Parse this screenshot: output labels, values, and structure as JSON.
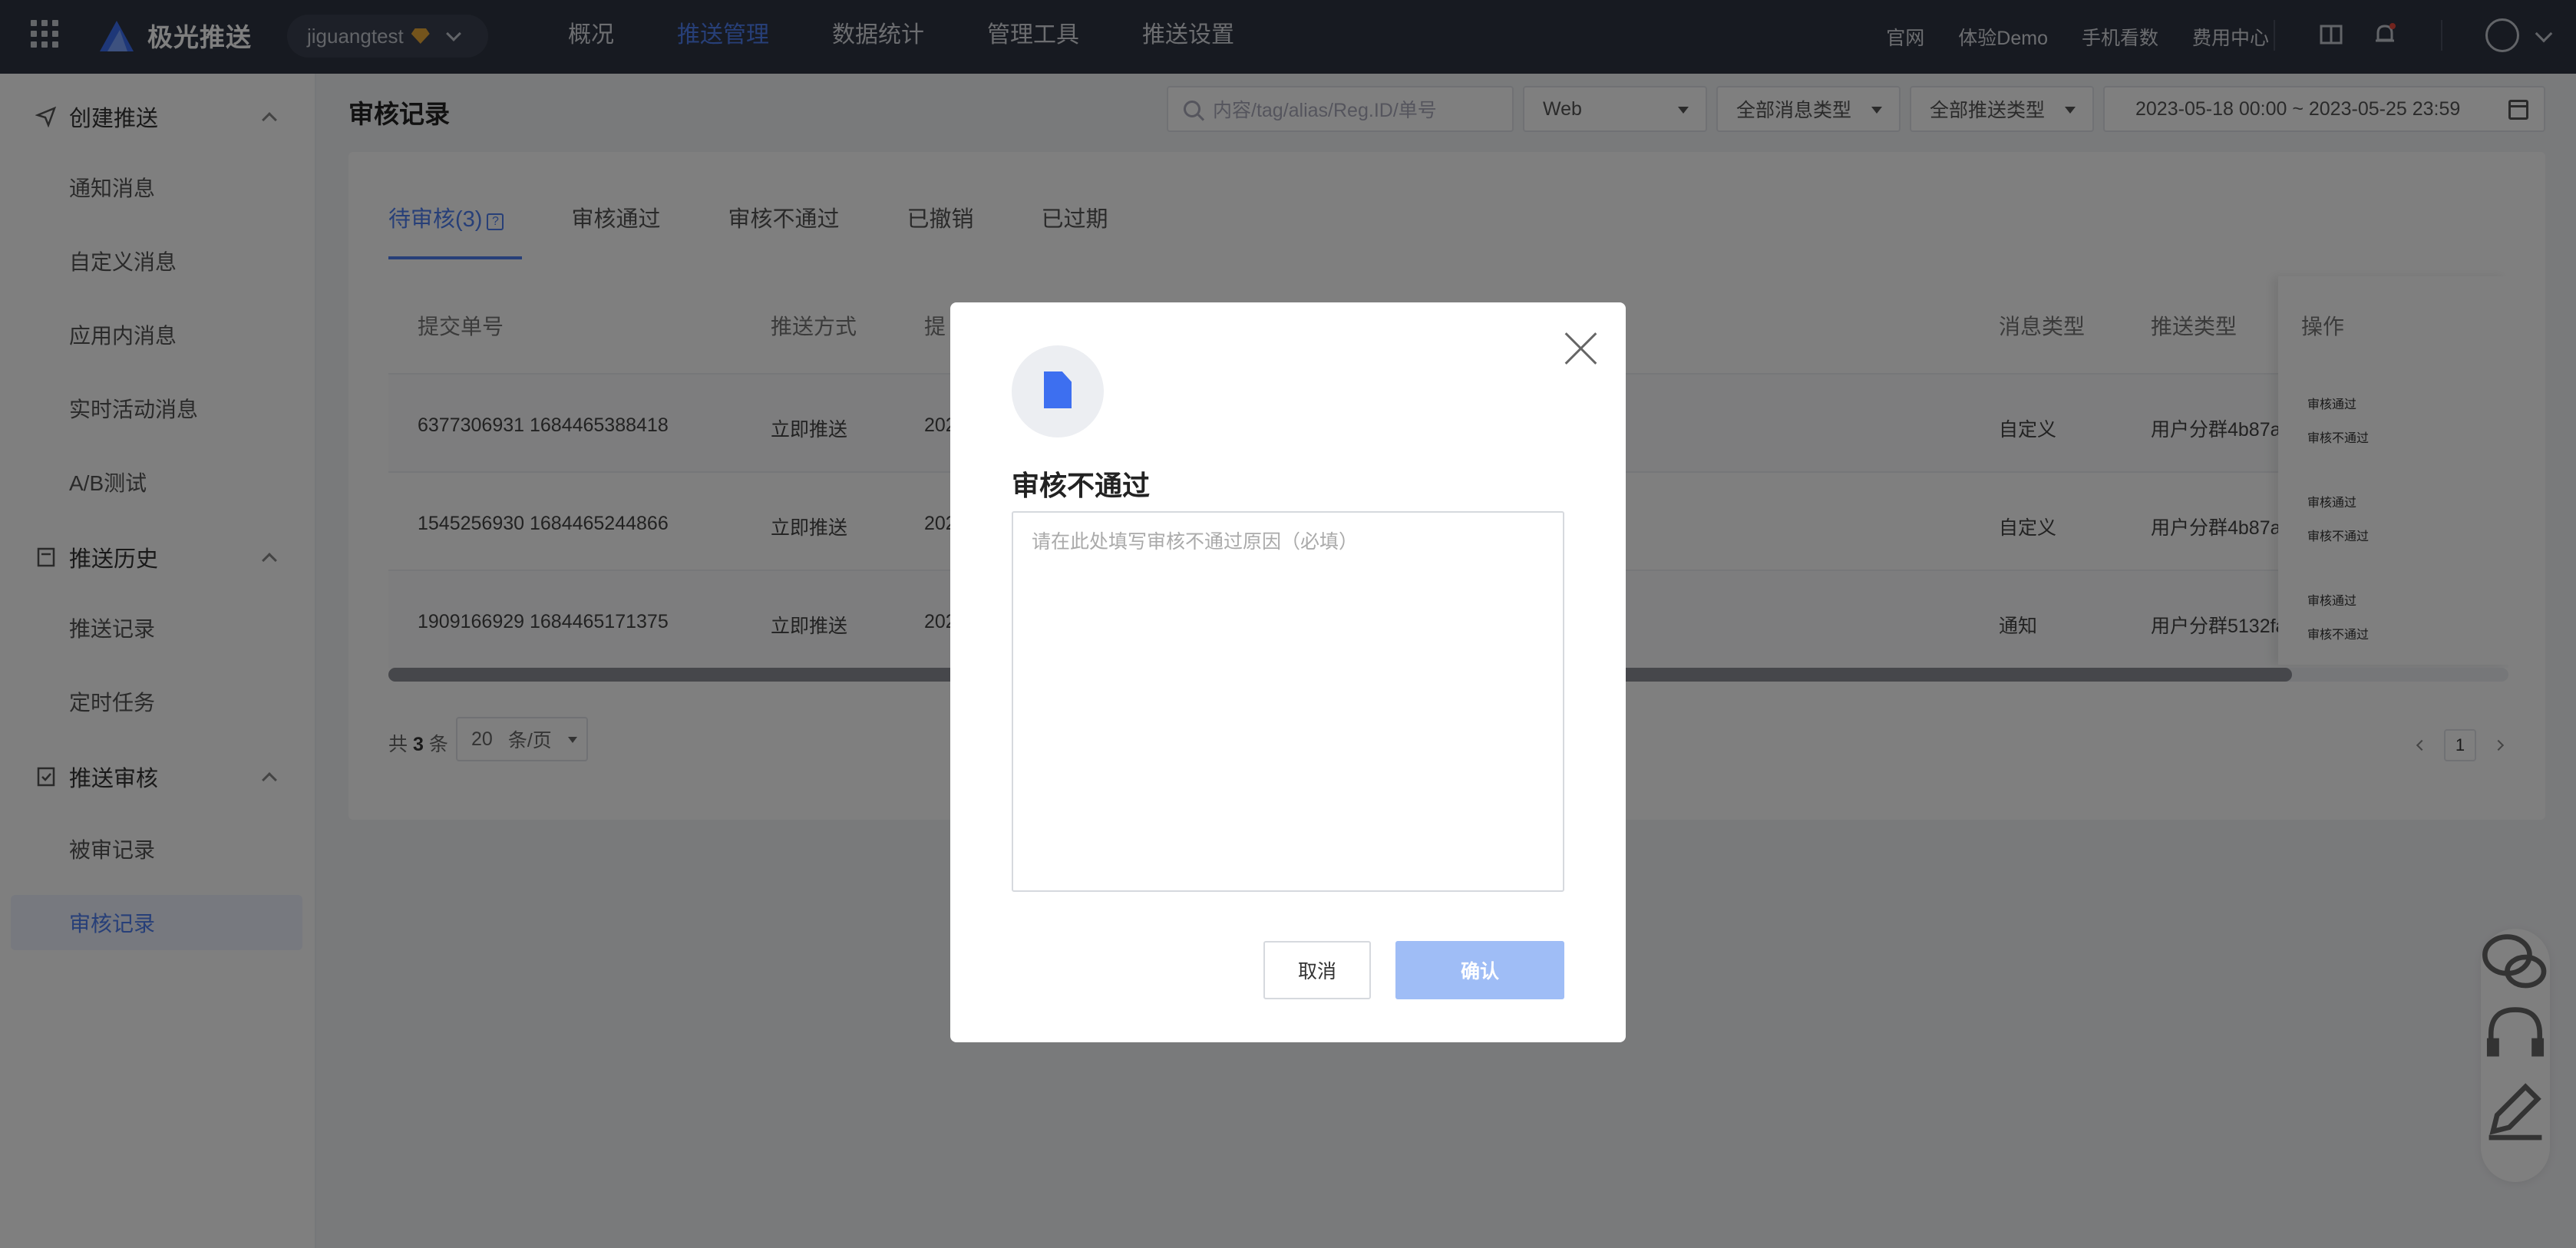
{
  "topbar": {
    "brand": "极光推送",
    "app": "jiguangtest",
    "nav": [
      "概况",
      "推送管理",
      "数据统计",
      "管理工具",
      "推送设置"
    ],
    "active_nav": "推送管理",
    "right_links": [
      "官网",
      "体验Demo",
      "手机看数",
      "费用中心"
    ],
    "icons": [
      "book-icon",
      "bell-icon",
      "user-icon"
    ]
  },
  "sidebar": {
    "groups": [
      {
        "label": "创建推送",
        "icon": "send-icon",
        "items": [
          "通知消息",
          "自定义消息",
          "应用内消息",
          "实时活动消息",
          "A/B测试"
        ]
      },
      {
        "label": "推送历史",
        "icon": "history-icon",
        "items": [
          "推送记录",
          "定时任务"
        ]
      },
      {
        "label": "推送审核",
        "icon": "audit-icon",
        "items": [
          "被审记录",
          "审核记录"
        ]
      }
    ],
    "active_item": "审核记录"
  },
  "page": {
    "title": "审核记录",
    "filters": {
      "search_placeholder": "内容/tag/alias/Reg.ID/单号",
      "platform": "Web",
      "msg_type": "全部消息类型",
      "push_type": "全部推送类型",
      "date_range": "2023-05-18 00:00 ~ 2023-05-25 23:59"
    },
    "tabs": [
      "待审核(3)",
      "审核通过",
      "审核不通过",
      "已撤销",
      "已过期"
    ],
    "active_tab": "待审核(3)",
    "columns": [
      "提交单号",
      "推送方式",
      "提",
      "消息类型",
      "推送类型",
      "操作"
    ],
    "rows": [
      {
        "id": "6377306931 1684465388418",
        "method": "立即推送",
        "time": "202",
        "msg_type": "自定义",
        "push_type": "用户分群4b87a",
        "ops": [
          "审核通过",
          "审核不通过"
        ]
      },
      {
        "id": "1545256930 1684465244866",
        "method": "立即推送",
        "time": "202",
        "msg_type": "自定义",
        "push_type": "用户分群4b87a",
        "ops": [
          "审核通过",
          "审核不通过"
        ]
      },
      {
        "id": "1909166929 1684465171375",
        "method": "立即推送",
        "time": "202",
        "msg_type": "通知",
        "push_type": "用户分群5132fa",
        "ops": [
          "审核通过",
          "审核不通过"
        ]
      }
    ],
    "pagination": {
      "total_prefix": "共",
      "total": "3",
      "total_suffix": "条",
      "page_size": "20",
      "page_size_unit": "条/页",
      "current_page": "1"
    }
  },
  "dialog": {
    "title": "审核不通过",
    "placeholder": "请在此处填写审核不通过原因（必填）",
    "cancel": "取消",
    "confirm": "确认"
  },
  "colors": {
    "accent": "#4f7ff0",
    "topbar": "#2f3542",
    "confirm_disabled": "#9fbdf6"
  }
}
